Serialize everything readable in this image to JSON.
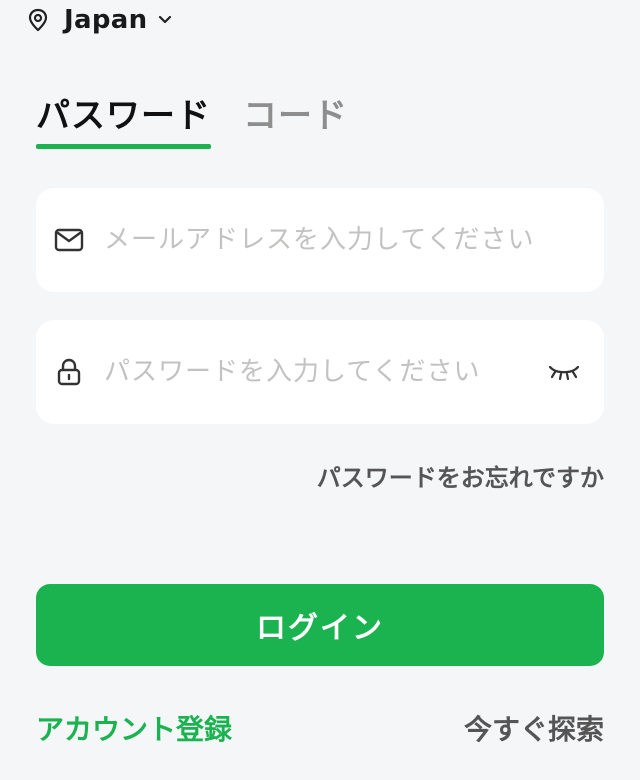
{
  "region": {
    "label": "Japan",
    "pin_icon": "location-pin-icon",
    "chevron_icon": "chevron-down-icon"
  },
  "tabs": [
    {
      "label": "パスワード",
      "active": true
    },
    {
      "label": "コード",
      "active": false
    }
  ],
  "email_field": {
    "icon": "mail-icon",
    "placeholder": "メールアドレスを入力してください",
    "value": ""
  },
  "password_field": {
    "icon": "lock-icon",
    "placeholder": "パスワードを入力してください",
    "value": "",
    "toggle_icon": "eye-closed-icon"
  },
  "forgot_password": "パスワードをお忘れですか",
  "login_button": "ログイン",
  "footer": {
    "signup": "アカウント登録",
    "explore": "今すぐ探索"
  },
  "colors": {
    "accent": "#1ab350",
    "background": "#f5f6f8",
    "field_background": "#ffffff",
    "placeholder": "#c2c2c0",
    "secondary_text": "#555555",
    "inactive_tab": "#8e8e8e"
  }
}
